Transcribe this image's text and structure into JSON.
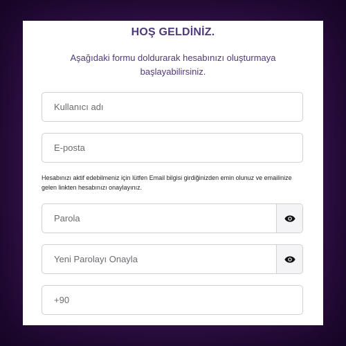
{
  "form": {
    "title": "HOŞ GELDİNİZ.",
    "subtitle": "Aşağıdaki formu doldurarak hesabınızı oluşturmaya başlayabilirsiniz.",
    "username_placeholder": "Kullanıcı adı",
    "email_placeholder": "E-posta",
    "email_note": "Hesabınızı aktif edebilmeniz için lütfen Email bilgisi girdiğinizden emin olunuz ve emailinize gelen linkten hesabınızı onaylayınız.",
    "password_placeholder": "Parola",
    "confirm_password_placeholder": "Yeni Parolayı Onayla",
    "phone_prefix": "+90"
  },
  "icons": {
    "password_toggle": "eye-icon",
    "confirm_toggle": "eye-icon"
  },
  "colors": {
    "title": "#4e3a78",
    "background": "#3a1454",
    "border": "#cfcfd6"
  }
}
